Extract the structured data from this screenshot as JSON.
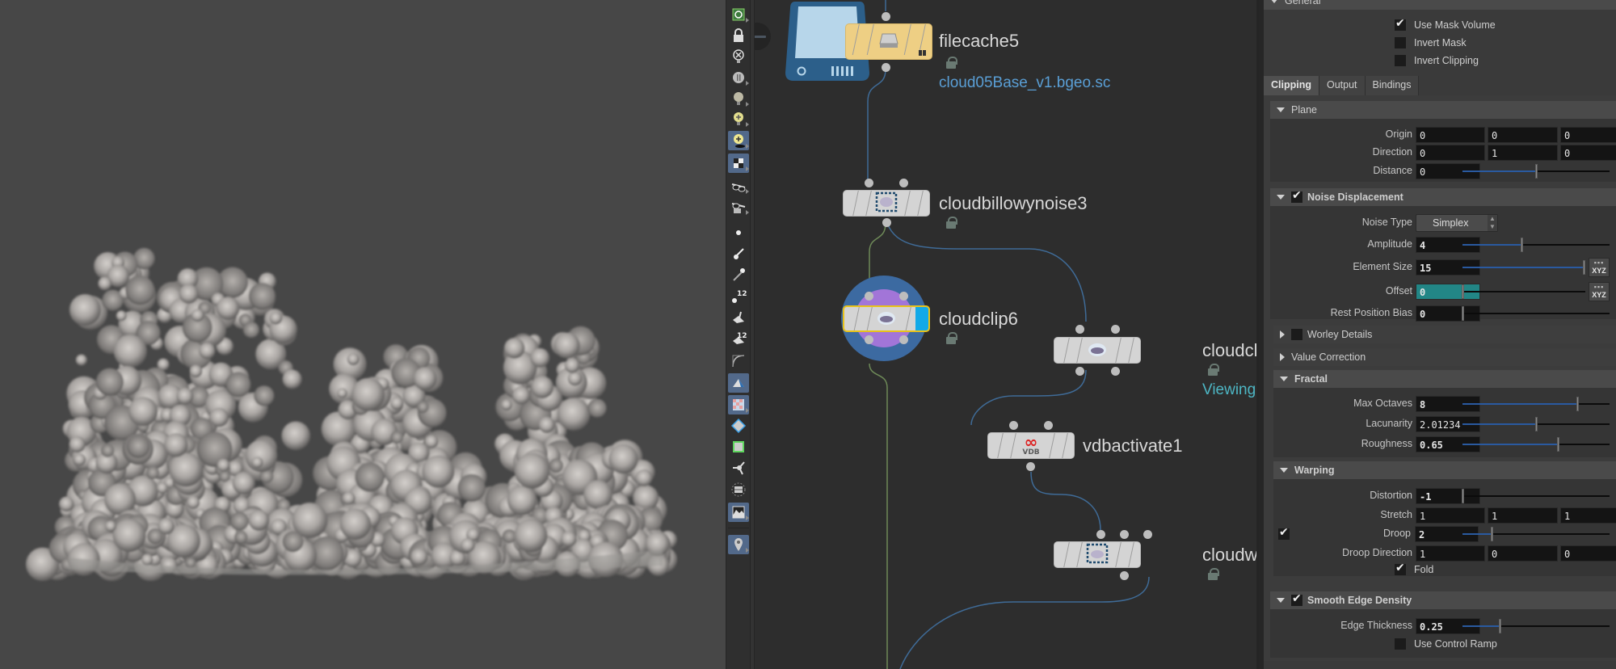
{
  "viewport": {
    "subject": "rendered-cloud-volume",
    "background_color": "#474747"
  },
  "toolbar": {
    "tools": [
      {
        "name": "select-mode-icon",
        "active": false
      },
      {
        "name": "lock-camera-icon",
        "active": false
      },
      {
        "name": "no-lights-icon",
        "active": false
      },
      {
        "name": "headlight-icon",
        "active": false
      },
      {
        "name": "normal-lighting-icon",
        "active": false
      },
      {
        "name": "high-quality-lighting-icon",
        "active": false
      },
      {
        "name": "high-quality-lighting-shadows-icon",
        "active": true
      },
      {
        "name": "ambient-occlusion-icon",
        "active": true
      },
      {
        "name": "stereo-glasses-icon",
        "active": false
      },
      {
        "name": "stereo-camera-icon",
        "active": false
      },
      {
        "name": "display-points-icon",
        "active": false
      },
      {
        "name": "point-normals-icon",
        "active": false
      },
      {
        "name": "point-trails-icon",
        "active": false
      },
      {
        "name": "point-numbers-icon",
        "active": false
      },
      {
        "name": "primitive-normals-icon",
        "active": false
      },
      {
        "name": "primitive-numbers-icon",
        "active": false
      },
      {
        "name": "hull-icon",
        "active": false
      },
      {
        "name": "shaded-backfaces-icon",
        "active": true
      },
      {
        "name": "uv-checker-icon",
        "active": true
      },
      {
        "name": "template-geometry-icon",
        "active": false
      },
      {
        "name": "unique-points-icon",
        "active": false
      },
      {
        "name": "transform-handle-icon",
        "active": false
      },
      {
        "name": "display-options-icon",
        "active": false
      },
      {
        "name": "background-image-icon",
        "active": true
      },
      {
        "name": "pin-icon",
        "active": true
      }
    ],
    "counter_label": "12"
  },
  "network": {
    "nodes": [
      {
        "id": "filecache5",
        "label": "filecache5",
        "sublabel": "cloud05Base_v1.bgeo.sc",
        "sublabel_color": "#5a9fd6",
        "type": "cache"
      },
      {
        "id": "cloudbillowynoise3",
        "label": "cloudbillowynoise3",
        "type": "noise"
      },
      {
        "id": "cloudclip6",
        "label": "cloudclip6",
        "type": "clip",
        "selected": true,
        "display_flag": true
      },
      {
        "id": "cloudclip-viewing",
        "label": "cloudcl",
        "sublabel": "Viewing",
        "sublabel_color": "#4db6c4",
        "type": "clip"
      },
      {
        "id": "vdbactivate1",
        "label": "vdbactivate1",
        "type": "vdb",
        "icon_text": "VDB"
      },
      {
        "id": "cloudw",
        "label": "cloudw",
        "type": "noise"
      }
    ],
    "wire_colors": {
      "default": "#3f6b97",
      "display": "#6e8a58"
    }
  },
  "params": {
    "general": {
      "label": "General",
      "use_mask_volume": {
        "label": "Use Mask Volume",
        "checked": true
      },
      "invert_mask": {
        "label": "Invert Mask",
        "checked": false
      },
      "invert_clipping": {
        "label": "Invert Clipping",
        "checked": false
      }
    },
    "tabs": [
      {
        "label": "Clipping",
        "active": true
      },
      {
        "label": "Output",
        "active": false
      },
      {
        "label": "Bindings",
        "active": false
      }
    ],
    "plane": {
      "label": "Plane",
      "origin": {
        "label": "Origin",
        "values": [
          "0",
          "0",
          "0"
        ]
      },
      "direction": {
        "label": "Direction",
        "values": [
          "0",
          "1",
          "0"
        ]
      },
      "distance": {
        "label": "Distance",
        "value": "0",
        "slider": 0.5
      }
    },
    "noise_displacement": {
      "label": "Noise Displacement",
      "enabled": true,
      "noise_type": {
        "label": "Noise Type",
        "value": "Simplex"
      },
      "amplitude": {
        "label": "Amplitude",
        "value": "4",
        "slider": 0.4
      },
      "element_size": {
        "label": "Element Size",
        "value": "15",
        "slider": 1.0
      },
      "offset": {
        "label": "Offset",
        "value": "0",
        "slider": 0.0
      },
      "rest_position_bias": {
        "label": "Rest Position Bias",
        "value": "0",
        "slider": 0.0
      },
      "xyz_label": "XYZ",
      "worley_details": {
        "label": "Worley Details",
        "enabled": false
      },
      "value_correction": {
        "label": "Value Correction"
      }
    },
    "fractal": {
      "label": "Fractal",
      "max_octaves": {
        "label": "Max Octaves",
        "value": "8",
        "slider": 0.78
      },
      "lacunarity": {
        "label": "Lacunarity",
        "value": "2.01234",
        "slider": 0.5
      },
      "roughness": {
        "label": "Roughness",
        "value": "0.65",
        "slider": 0.65
      }
    },
    "warping": {
      "label": "Warping",
      "distortion": {
        "label": "Distortion",
        "value": "-1",
        "slider": 0.0
      },
      "stretch": {
        "label": "Stretch",
        "values": [
          "1",
          "1",
          "1"
        ]
      },
      "droop": {
        "label": "Droop",
        "value": "2",
        "slider": 0.2,
        "enabled": true
      },
      "droop_direction": {
        "label": "Droop Direction",
        "values": [
          "1",
          "0",
          "0"
        ]
      },
      "fold": {
        "label": "Fold",
        "checked": true
      }
    },
    "smooth_edge_density": {
      "label": "Smooth Edge Density",
      "enabled": true,
      "edge_thickness": {
        "label": "Edge Thickness",
        "value": "0.25",
        "slider": 0.25
      },
      "use_control_ramp": {
        "label": "Use Control Ramp",
        "checked": false
      }
    }
  }
}
